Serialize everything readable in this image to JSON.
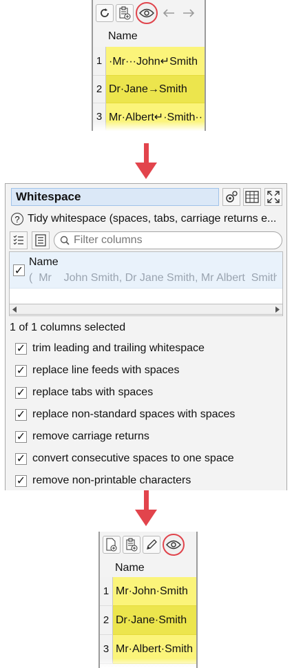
{
  "top_grid": {
    "toolbar_icons": [
      "refresh-icon",
      "paste-icon",
      "eye-icon",
      "back-arrow-icon",
      "forward-arrow-icon"
    ],
    "column_header": "Name",
    "rows": [
      {
        "num": "1",
        "value": "·Mr···John↵Smith"
      },
      {
        "num": "2",
        "value": "Dr·Jane→Smith"
      },
      {
        "num": "3",
        "value": "Mr·Albert↵·Smith··"
      }
    ]
  },
  "transform": {
    "title": "Whitespace",
    "description": "Tidy whitespace (spaces, tabs, carriage returns e...",
    "filter_placeholder": "Filter columns",
    "column": {
      "name": "Name",
      "preview": "(  Mr    John Smith, Dr Jane Smith, Mr Albert  Smith"
    },
    "selected_count": "1 of 1 columns selected",
    "options": [
      {
        "label": "trim leading and trailing whitespace",
        "checked": true
      },
      {
        "label": "replace line feeds with spaces",
        "checked": true
      },
      {
        "label": "replace tabs with spaces",
        "checked": true
      },
      {
        "label": "replace non-standard spaces with spaces",
        "checked": true
      },
      {
        "label": "remove carriage returns",
        "checked": true
      },
      {
        "label": "convert consecutive spaces to one space",
        "checked": true
      },
      {
        "label": "remove non-printable characters",
        "checked": true
      }
    ]
  },
  "bottom_grid": {
    "toolbar_icons": [
      "new-file-icon",
      "paste-icon",
      "pencil-icon",
      "eye-icon"
    ],
    "column_header": "Name",
    "rows": [
      {
        "num": "1",
        "value": "Mr·John·Smith"
      },
      {
        "num": "2",
        "value": "Dr·Jane·Smith"
      },
      {
        "num": "3",
        "value": "Mr·Albert·Smith"
      }
    ]
  },
  "colors": {
    "accent": "#e2444c",
    "cell_yellow": "#fbf47a",
    "cell_yellow_alt": "#ece54d",
    "title_blue": "#dbe8f7"
  }
}
